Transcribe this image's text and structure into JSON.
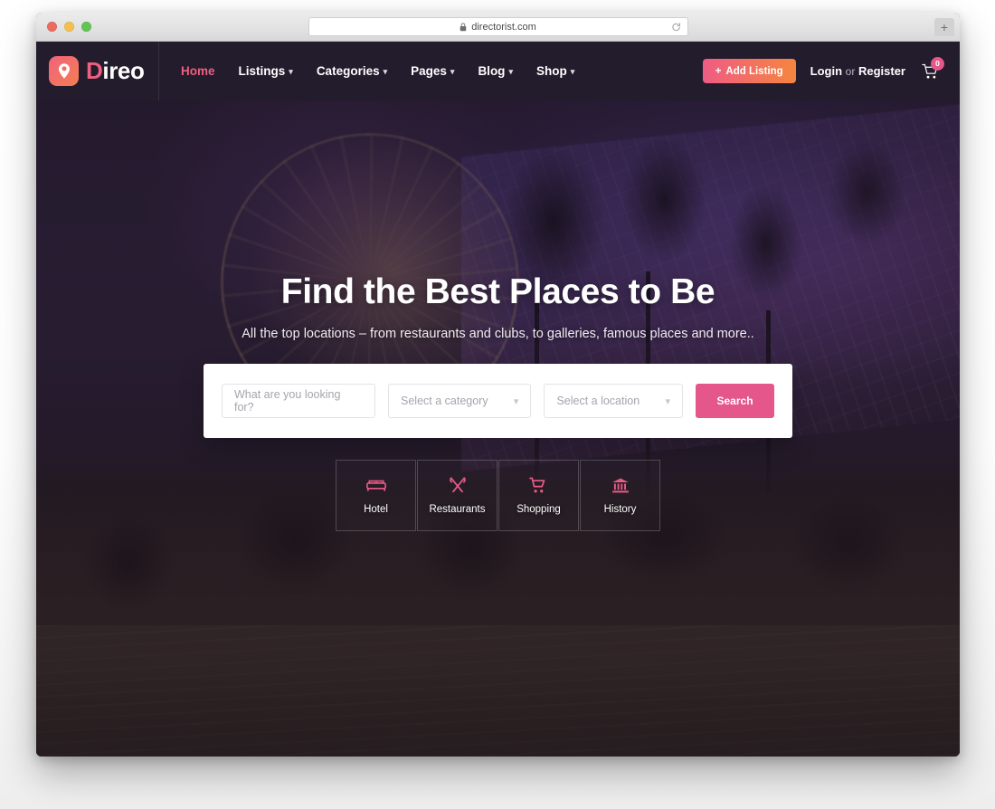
{
  "browser": {
    "url": "directorist.com",
    "lock_icon": "lock-icon",
    "reload_icon": "reload-icon",
    "newtab_label": "+",
    "traffic_lights": [
      "close",
      "minimize",
      "maximize"
    ]
  },
  "header": {
    "logo": {
      "text_prefix": "D",
      "text_rest": "ireo",
      "mark_icon": "map-pin-icon",
      "gradient_from": "#f0637c",
      "gradient_to": "#f47e52"
    },
    "nav": [
      {
        "label": "Home",
        "has_dropdown": false,
        "active": true
      },
      {
        "label": "Listings",
        "has_dropdown": true,
        "active": false
      },
      {
        "label": "Categories",
        "has_dropdown": true,
        "active": false
      },
      {
        "label": "Pages",
        "has_dropdown": true,
        "active": false
      },
      {
        "label": "Blog",
        "has_dropdown": true,
        "active": false
      },
      {
        "label": "Shop",
        "has_dropdown": true,
        "active": false
      }
    ],
    "add_listing_label": "Add Listing",
    "add_listing_plus": "+",
    "login_label": "Login",
    "or_label": "or",
    "register_label": "Register",
    "cart_icon": "shopping-cart-icon",
    "cart_count": "0",
    "background_color": "#231c2c",
    "accent_color": "#ef5f7f"
  },
  "hero": {
    "title": "Find the Best Places to Be",
    "subtitle": "All the top locations – from restaurants and clubs, to galleries, famous places and more.."
  },
  "search": {
    "keyword_placeholder": "What are you looking for?",
    "category_placeholder": "Select a category",
    "location_placeholder": "Select a location",
    "category_chevron": "chevron-down-icon",
    "location_chevron": "chevron-down-icon",
    "button_label": "Search",
    "button_color": "#e5568a"
  },
  "categories": [
    {
      "label": "Hotel",
      "icon": "bed-icon"
    },
    {
      "label": "Restaurants",
      "icon": "cutlery-icon"
    },
    {
      "label": "Shopping",
      "icon": "shopping-cart-icon"
    },
    {
      "label": "History",
      "icon": "museum-icon"
    }
  ]
}
